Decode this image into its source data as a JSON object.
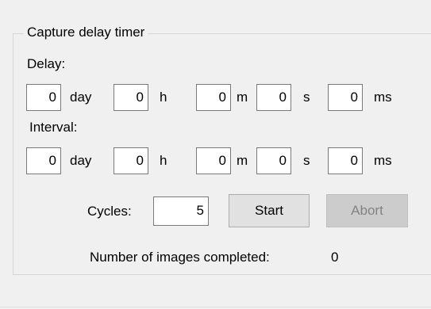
{
  "group_title": "Capture delay timer",
  "delay": {
    "label": "Delay:",
    "values": {
      "day": "0",
      "h": "0",
      "m": "0",
      "s": "0",
      "ms": "0"
    }
  },
  "interval": {
    "label": "Interval:",
    "values": {
      "day": "0",
      "h": "0",
      "m": "0",
      "s": "0",
      "ms": "0"
    }
  },
  "units": {
    "day": "day",
    "h": "h",
    "m": "m",
    "s": "s",
    "ms": "ms"
  },
  "cycles": {
    "label": "Cycles:",
    "value": "5"
  },
  "buttons": {
    "start": "Start",
    "abort": "Abort"
  },
  "images_completed": {
    "label": "Number of images completed:",
    "value": "0"
  },
  "colors": {
    "background": "#f0f0f0",
    "button": "#e1e1e1",
    "button_disabled": "#cccccc"
  }
}
